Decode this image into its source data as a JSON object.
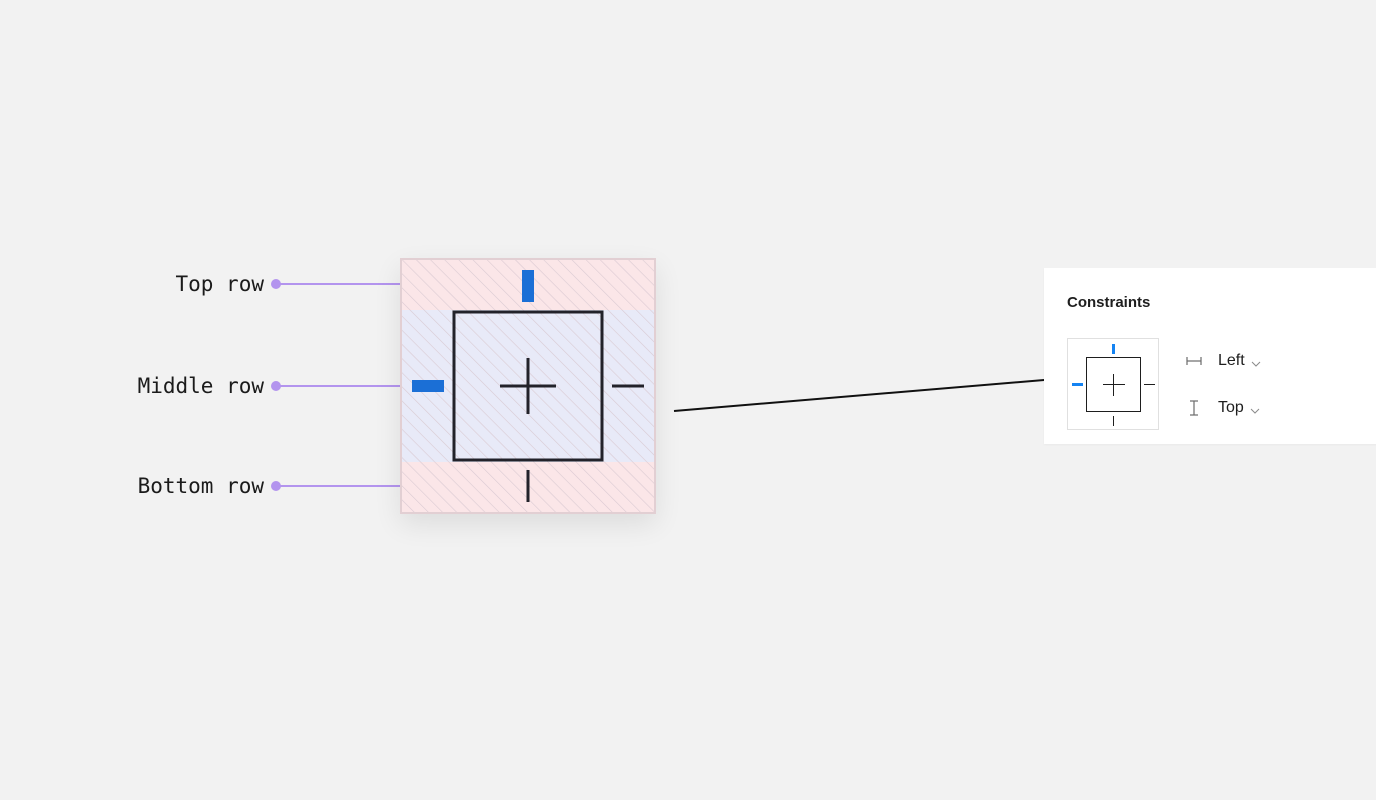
{
  "annotations": {
    "top_row": "Top row",
    "middle_row": "Middle row",
    "bottom_row": "Bottom row",
    "leader_color": "#b394ee"
  },
  "diagram": {
    "edge_zone_color": "#fbe6e8",
    "middle_zone_color": "#e8eaf8",
    "hatch_color": "#d9c9d2",
    "active_color": "#1b6fd6",
    "inactive_color": "#22222a"
  },
  "panel": {
    "title": "Constraints",
    "horizontal": {
      "icon": "horizontal-constraint-icon",
      "value": "Left"
    },
    "vertical": {
      "icon": "vertical-constraint-icon",
      "value": "Top"
    },
    "active_color": "#1483f2"
  }
}
